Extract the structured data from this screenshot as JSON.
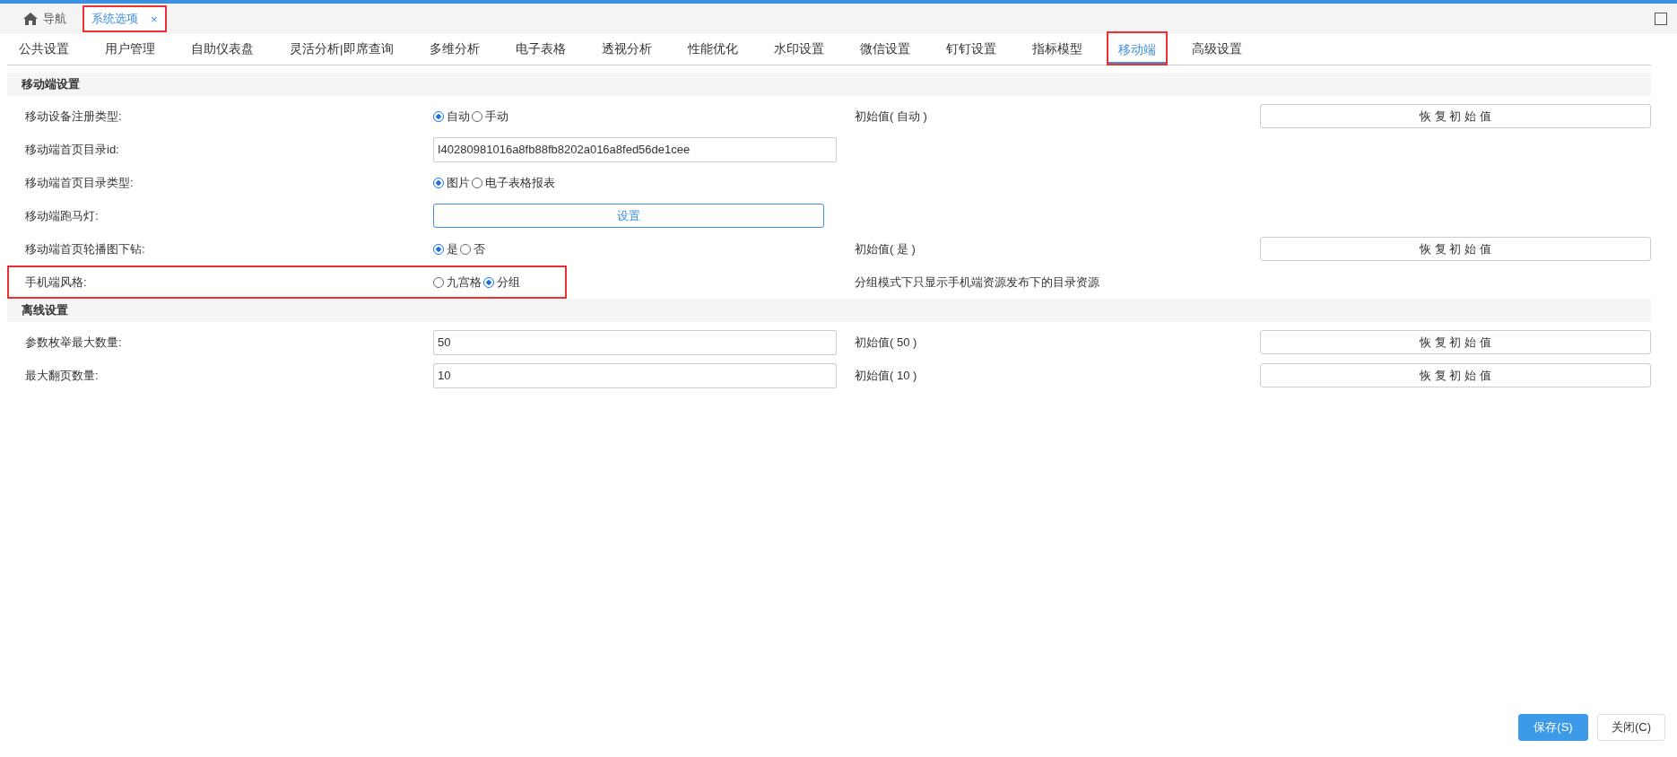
{
  "page_tabs": [
    {
      "label": "导航",
      "kind": "home",
      "selected": false,
      "highlighted": false
    },
    {
      "label": "系统选项",
      "kind": "closable",
      "close": "×",
      "selected": true,
      "highlighted": true
    }
  ],
  "settings_tabs": [
    {
      "label": "公共设置",
      "selected": false,
      "highlighted": false
    },
    {
      "label": "用户管理",
      "selected": false,
      "highlighted": false
    },
    {
      "label": "自助仪表盘",
      "selected": false,
      "highlighted": false
    },
    {
      "label": "灵活分析|即席查询",
      "selected": false,
      "highlighted": false
    },
    {
      "label": "多维分析",
      "selected": false,
      "highlighted": false
    },
    {
      "label": "电子表格",
      "selected": false,
      "highlighted": false
    },
    {
      "label": "透视分析",
      "selected": false,
      "highlighted": false
    },
    {
      "label": "性能优化",
      "selected": false,
      "highlighted": false
    },
    {
      "label": "水印设置",
      "selected": false,
      "highlighted": false
    },
    {
      "label": "微信设置",
      "selected": false,
      "highlighted": false
    },
    {
      "label": "钉钉设置",
      "selected": false,
      "highlighted": false
    },
    {
      "label": "指标模型",
      "selected": false,
      "highlighted": false
    },
    {
      "label": "移动端",
      "selected": true,
      "highlighted": true
    },
    {
      "label": "高级设置",
      "selected": false,
      "highlighted": false
    }
  ],
  "sections": [
    {
      "title": "移动端设置",
      "rows": [
        {
          "label": "移动设备注册类型:",
          "kind": "radio",
          "options": [
            {
              "label": "自动",
              "selected": true
            },
            {
              "label": "手动",
              "selected": false
            }
          ],
          "initial": "初始值( 自动 )",
          "restore": "恢 复 初 始 值",
          "highlighted": false
        },
        {
          "label": "移动端首页目录id:",
          "kind": "text",
          "value": "I40280981016a8fb88fb8202a016a8fed56de1cee",
          "highlighted": false
        },
        {
          "label": "移动端首页目录类型:",
          "kind": "radio",
          "options": [
            {
              "label": "图片",
              "selected": true
            },
            {
              "label": "电子表格报表",
              "selected": false
            }
          ],
          "highlighted": false
        },
        {
          "label": "移动端跑马灯:",
          "kind": "button",
          "button": "设置",
          "highlighted": false
        },
        {
          "label": "移动端首页轮播图下钻:",
          "kind": "radio",
          "options": [
            {
              "label": "是",
              "selected": true
            },
            {
              "label": "否",
              "selected": false
            }
          ],
          "initial": "初始值( 是 )",
          "restore": "恢 复 初 始 值",
          "highlighted": false
        },
        {
          "label": "手机端风格:",
          "kind": "radio",
          "options": [
            {
              "label": "九宫格",
              "selected": false
            },
            {
              "label": "分组",
              "selected": true
            }
          ],
          "note": "分组模式下只显示手机端资源发布下的目录资源",
          "highlighted": true
        }
      ]
    },
    {
      "title": "离线设置",
      "rows": [
        {
          "label": "参数枚举最大数量:",
          "kind": "text",
          "value": "50",
          "initial": "初始值( 50 )",
          "restore": "恢 复 初 始 值",
          "highlighted": false
        },
        {
          "label": "最大翻页数量:",
          "kind": "text",
          "value": "10",
          "initial": "初始值( 10 )",
          "restore": "恢 复 初 始 值",
          "highlighted": false
        }
      ]
    }
  ],
  "footer": [
    {
      "label": "保存(S)",
      "kind": "primary"
    },
    {
      "label": "关闭(C)",
      "kind": "default"
    }
  ]
}
